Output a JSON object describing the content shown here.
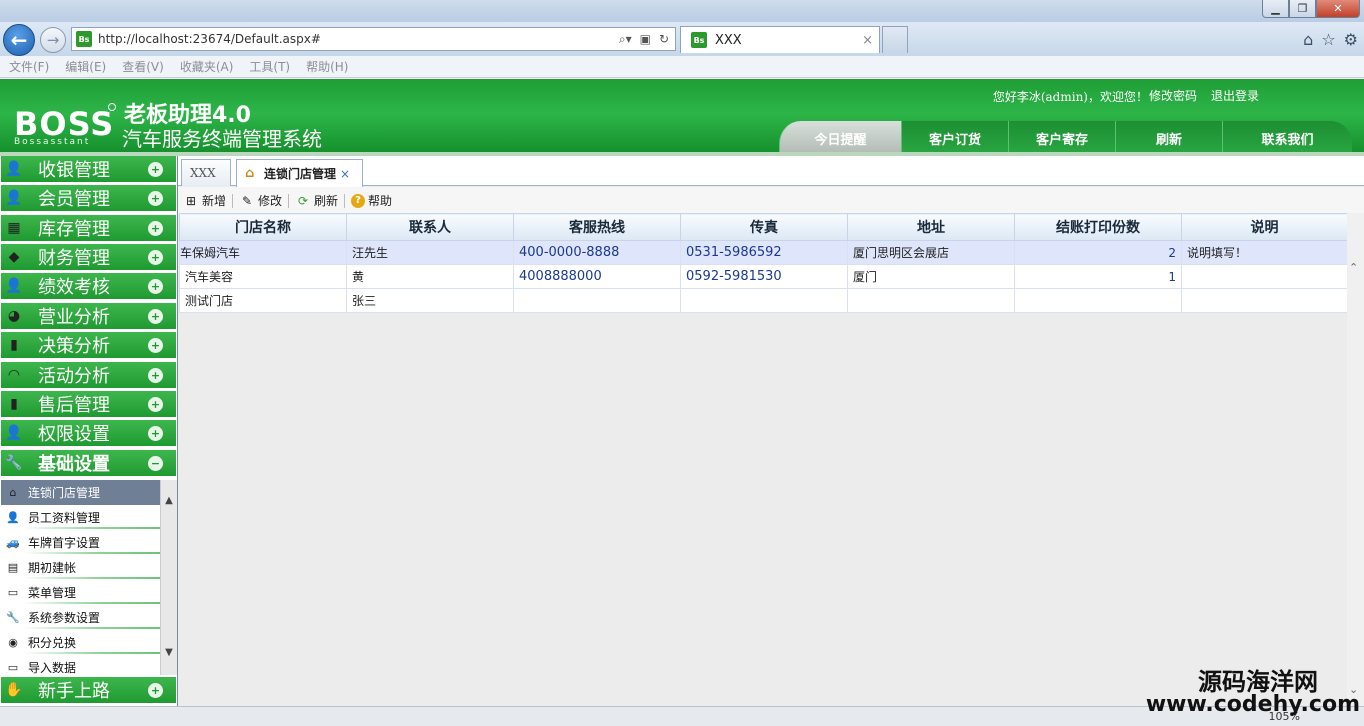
{
  "browser": {
    "url": "http://localhost:23674/Default.aspx#",
    "tab_title": "XXX",
    "tab_close": "×",
    "menu": [
      "文件(F)",
      "编辑(E)",
      "查看(V)",
      "收藏夹(A)",
      "工具(T)",
      "帮助(H)"
    ],
    "zoom": "105%"
  },
  "header": {
    "brand": "BOSS",
    "brand_sub": "Bossasstant",
    "product": "老板助理4.0",
    "subtitle": "汽车服务终端管理系统",
    "greeting": "您好李冰(admin)，欢迎您！",
    "change_password": "修改密码",
    "logout": "退出登录",
    "tabs": [
      "今日提醒",
      "客户订货",
      "客户寄存",
      "刷新",
      "联系我们"
    ]
  },
  "sidebar": {
    "items": [
      {
        "label": "收银管理",
        "icon": "cashier-icon"
      },
      {
        "label": "会员管理",
        "icon": "member-icon"
      },
      {
        "label": "库存管理",
        "icon": "inventory-icon"
      },
      {
        "label": "财务管理",
        "icon": "finance-icon"
      },
      {
        "label": "绩效考核",
        "icon": "performance-icon"
      },
      {
        "label": "营业分析",
        "icon": "business-analysis-icon"
      },
      {
        "label": "决策分析",
        "icon": "decision-icon"
      },
      {
        "label": "活动分析",
        "icon": "activity-icon"
      },
      {
        "label": "售后管理",
        "icon": "after-sales-icon"
      },
      {
        "label": "权限设置",
        "icon": "permission-icon"
      },
      {
        "label": "基础设置",
        "icon": "wrench-icon"
      }
    ],
    "submenu": [
      {
        "label": "连锁门店管理",
        "icon": "home-icon"
      },
      {
        "label": "员工资料管理",
        "icon": "user-icon"
      },
      {
        "label": "车牌首字设置",
        "icon": "car-icon"
      },
      {
        "label": "期初建帐",
        "icon": "ledger-icon"
      },
      {
        "label": "菜单管理",
        "icon": "menu-icon"
      },
      {
        "label": "系统参数设置",
        "icon": "tools-icon"
      },
      {
        "label": "积分兑换",
        "icon": "gift-icon"
      },
      {
        "label": "导入数据",
        "icon": "import-icon"
      }
    ],
    "footer_item": {
      "label": "新手上路",
      "icon": "hand-icon"
    }
  },
  "panel_tabs": [
    {
      "label": "XXX"
    },
    {
      "label": "连锁门店管理",
      "close": "×"
    }
  ],
  "toolbar": {
    "add": "新增",
    "edit": "修改",
    "refresh": "刷新",
    "help": "帮助"
  },
  "table": {
    "columns": [
      "门店名称",
      "联系人",
      "客服热线",
      "传真",
      "地址",
      "结账打印份数",
      "说明"
    ],
    "rows": [
      [
        "车保姆汽车",
        "汪先生",
        "400-0000-8888",
        "0531-5986592",
        "厦门思明区会展店",
        "2",
        "说明填写！"
      ],
      [
        "汽车美容",
        "黄",
        "4008888000",
        "0592-5981530",
        "厦门",
        "1",
        ""
      ],
      [
        "测试门店",
        "张三",
        "",
        "",
        "",
        "",
        ""
      ]
    ]
  },
  "watermark": {
    "cn": "源码海洋网",
    "en": "www.codehy.com"
  }
}
